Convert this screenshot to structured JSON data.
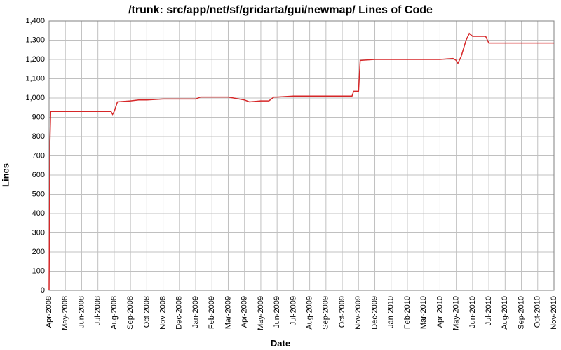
{
  "chart_data": {
    "type": "line",
    "title": "/trunk: src/app/net/sf/gridarta/gui/newmap/ Lines of Code",
    "xlabel": "Date",
    "ylabel": "Lines",
    "ylim": [
      0,
      1400
    ],
    "yticks": [
      0,
      100,
      200,
      300,
      400,
      500,
      600,
      700,
      800,
      900,
      1000,
      1100,
      1200,
      1300,
      1400
    ],
    "ytick_labels": [
      "0",
      "100",
      "200",
      "300",
      "400",
      "500",
      "600",
      "700",
      "800",
      "900",
      "1,000",
      "1,100",
      "1,200",
      "1,300",
      "1,400"
    ],
    "categories": [
      "Apr-2008",
      "May-2008",
      "Jun-2008",
      "Jul-2008",
      "Aug-2008",
      "Sep-2008",
      "Oct-2008",
      "Nov-2008",
      "Dec-2008",
      "Jan-2009",
      "Feb-2009",
      "Mar-2009",
      "Apr-2009",
      "May-2009",
      "Jun-2009",
      "Jul-2009",
      "Aug-2009",
      "Sep-2009",
      "Oct-2009",
      "Nov-2009",
      "Dec-2009",
      "Jan-2010",
      "Feb-2010",
      "Mar-2010",
      "Apr-2010",
      "May-2010",
      "Jun-2010",
      "Jul-2010",
      "Aug-2010",
      "Sep-2010",
      "Oct-2010",
      "Nov-2010"
    ],
    "series": [
      {
        "name": "Lines of Code",
        "points": [
          {
            "xi": 0.0,
            "y": 0
          },
          {
            "xi": 0.05,
            "y": 770
          },
          {
            "xi": 0.1,
            "y": 930
          },
          {
            "xi": 1.0,
            "y": 930
          },
          {
            "xi": 2.0,
            "y": 930
          },
          {
            "xi": 3.0,
            "y": 930
          },
          {
            "xi": 3.8,
            "y": 930
          },
          {
            "xi": 3.9,
            "y": 915
          },
          {
            "xi": 4.0,
            "y": 930
          },
          {
            "xi": 4.2,
            "y": 980
          },
          {
            "xi": 5.0,
            "y": 985
          },
          {
            "xi": 5.5,
            "y": 990
          },
          {
            "xi": 6.0,
            "y": 990
          },
          {
            "xi": 7.0,
            "y": 995
          },
          {
            "xi": 8.0,
            "y": 995
          },
          {
            "xi": 9.0,
            "y": 995
          },
          {
            "xi": 9.3,
            "y": 1005
          },
          {
            "xi": 10.0,
            "y": 1005
          },
          {
            "xi": 11.0,
            "y": 1005
          },
          {
            "xi": 12.0,
            "y": 990
          },
          {
            "xi": 12.3,
            "y": 980
          },
          {
            "xi": 13.0,
            "y": 985
          },
          {
            "xi": 13.5,
            "y": 985
          },
          {
            "xi": 13.8,
            "y": 1005
          },
          {
            "xi": 14.0,
            "y": 1005
          },
          {
            "xi": 15.0,
            "y": 1010
          },
          {
            "xi": 16.0,
            "y": 1010
          },
          {
            "xi": 17.0,
            "y": 1010
          },
          {
            "xi": 18.0,
            "y": 1010
          },
          {
            "xi": 18.6,
            "y": 1010
          },
          {
            "xi": 18.7,
            "y": 1035
          },
          {
            "xi": 19.0,
            "y": 1035
          },
          {
            "xi": 19.1,
            "y": 1195
          },
          {
            "xi": 20.0,
            "y": 1200
          },
          {
            "xi": 21.0,
            "y": 1200
          },
          {
            "xi": 22.0,
            "y": 1200
          },
          {
            "xi": 23.0,
            "y": 1200
          },
          {
            "xi": 24.0,
            "y": 1200
          },
          {
            "xi": 24.8,
            "y": 1205
          },
          {
            "xi": 25.0,
            "y": 1195
          },
          {
            "xi": 25.1,
            "y": 1180
          },
          {
            "xi": 25.3,
            "y": 1215
          },
          {
            "xi": 25.6,
            "y": 1300
          },
          {
            "xi": 25.8,
            "y": 1335
          },
          {
            "xi": 26.0,
            "y": 1320
          },
          {
            "xi": 26.8,
            "y": 1320
          },
          {
            "xi": 27.0,
            "y": 1285
          },
          {
            "xi": 28.0,
            "y": 1285
          },
          {
            "xi": 29.0,
            "y": 1285
          },
          {
            "xi": 30.0,
            "y": 1285
          },
          {
            "xi": 31.0,
            "y": 1285
          }
        ]
      }
    ]
  }
}
